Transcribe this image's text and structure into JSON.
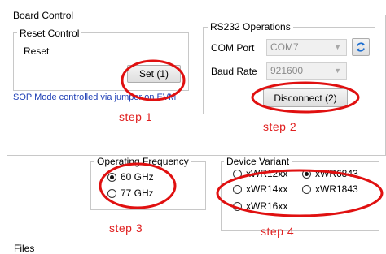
{
  "board_control": {
    "title": "Board Control",
    "reset_control": {
      "title": "Reset Control",
      "label": "Reset",
      "set_button": "Set (1)"
    },
    "sop_note": "SOP Mode controlled via jumper on EVM"
  },
  "rs232": {
    "title": "RS232 Operations",
    "com_port_label": "COM Port",
    "com_port_value": "COM7",
    "baud_rate_label": "Baud Rate",
    "baud_rate_value": "921600",
    "disconnect_button": "Disconnect (2)"
  },
  "operating_frequency": {
    "title": "Operating Frequency",
    "options": [
      {
        "label": "60 GHz",
        "selected": true
      },
      {
        "label": "77 GHz",
        "selected": false
      }
    ]
  },
  "device_variant": {
    "title": "Device Variant",
    "options": [
      {
        "label": "xWR12xx",
        "selected": false
      },
      {
        "label": "xWR6843",
        "selected": true
      },
      {
        "label": "xWR14xx",
        "selected": false
      },
      {
        "label": "xWR1843",
        "selected": false
      },
      {
        "label": "xWR16xx",
        "selected": false
      }
    ]
  },
  "annotations": {
    "step1": "step 1",
    "step2": "step 2",
    "step3": "step 3",
    "step4": "step 4",
    "color": "#e01010"
  },
  "footer": {
    "files_label": "Files"
  }
}
